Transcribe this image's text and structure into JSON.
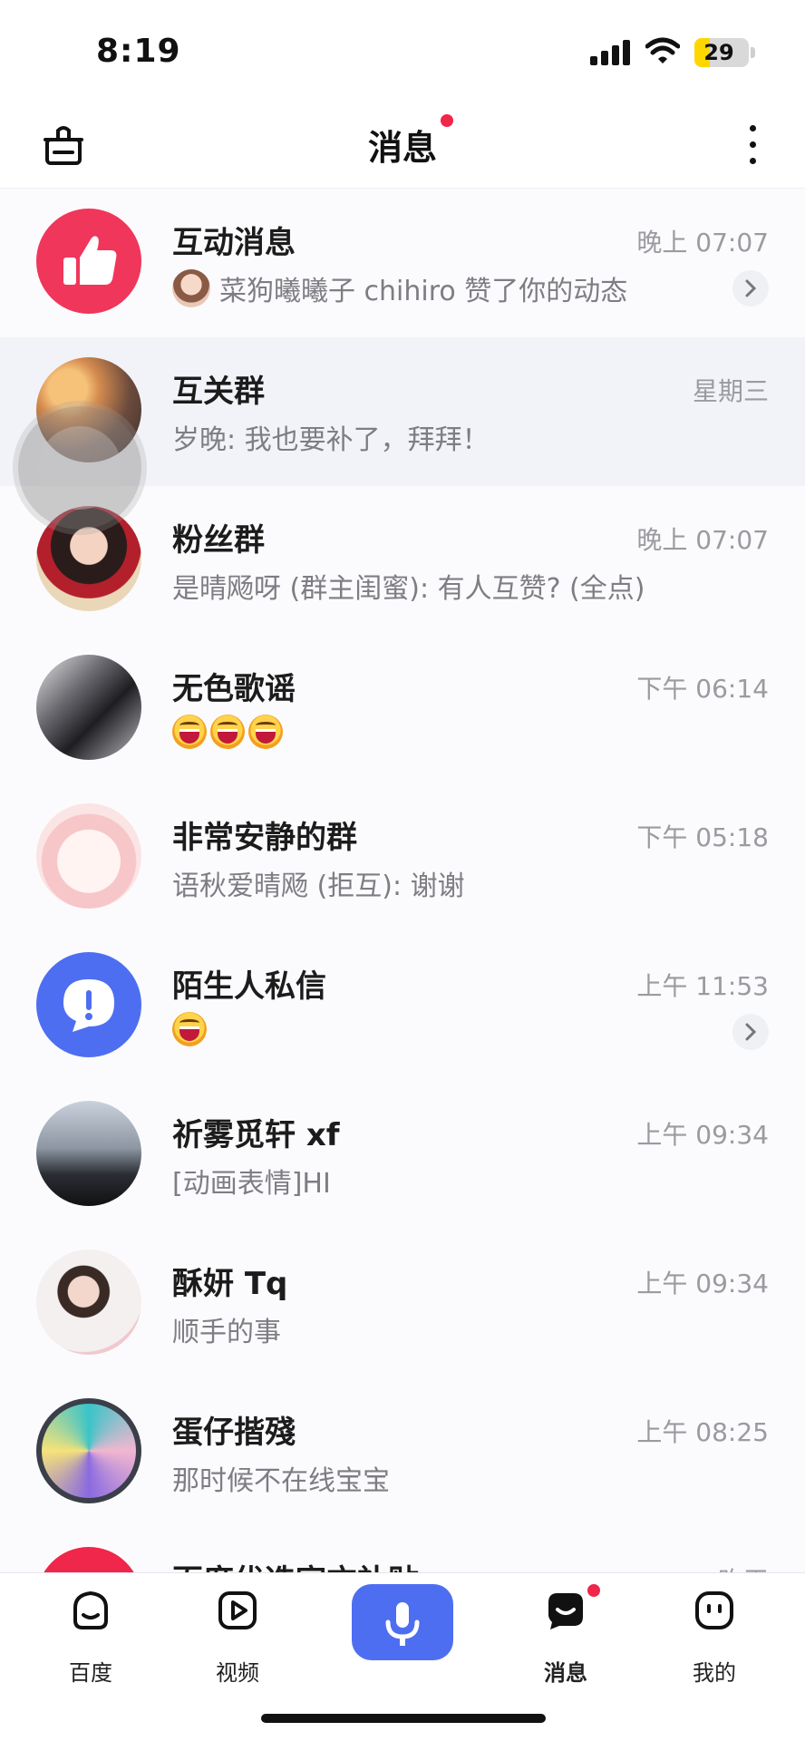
{
  "status_bar": {
    "time": "8:19",
    "battery": "29",
    "battery_level": 0.29
  },
  "header": {
    "title": "消息",
    "has_unread_dot": true
  },
  "conversations": [
    {
      "name": "互动消息",
      "time": "晚上 07:07",
      "preview": "菜狗曦曦子 chihiro 赞了你的动态",
      "avatar": "thumbs-up-icon",
      "avatar_color": "#f0365a",
      "has_chevron": true
    },
    {
      "name": "互关群",
      "time": "星期三",
      "preview": "岁晚: 我也要补了，拜拜！",
      "avatar": "group-photo-sunset"
    },
    {
      "name": "粉丝群",
      "time": "晚上 07:07",
      "preview": "是晴飏呀 (群主闺蜜): 有人互赞? (全点)",
      "avatar": "group-photo-girl"
    },
    {
      "name": "无色歌谣",
      "time": "下午 06:14",
      "preview": "",
      "emoji_count": 3,
      "avatar": "photo-mono"
    },
    {
      "name": "非常安静的群",
      "time": "下午 05:18",
      "preview": "语秋爱晴飏 (拒互): 谢谢",
      "avatar": "photo-cartoon-pink"
    },
    {
      "name": "陌生人私信",
      "time": "上午 11:53",
      "preview": "",
      "emoji_count": 1,
      "avatar": "exclamation-bubble-icon",
      "avatar_color": "#4e6ef2",
      "has_chevron": true
    },
    {
      "name": "祈雾觅轩 xf",
      "time": "上午 09:34",
      "preview": "[动画表情]HI",
      "avatar": "photo-night"
    },
    {
      "name": "酥妍 Tq",
      "time": "上午 09:34",
      "preview": "顺手的事",
      "avatar": "photo-girl-white"
    },
    {
      "name": "蛋仔揩殘",
      "time": "上午 08:25",
      "preview": "那时候不在线宝宝",
      "avatar": "photo-game-colorful"
    },
    {
      "name": "百度优选官方补贴",
      "time": "昨天",
      "preview": "",
      "avatar": "baidu-red"
    }
  ],
  "nav": {
    "items": [
      {
        "label": "百度",
        "icon": "baidu-face-icon"
      },
      {
        "label": "视频",
        "icon": "video-play-icon"
      },
      {
        "label": "",
        "icon": "microphone-icon"
      },
      {
        "label": "消息",
        "icon": "message-icon",
        "active": true,
        "badge": true
      },
      {
        "label": "我的",
        "icon": "profile-face-icon"
      }
    ]
  }
}
